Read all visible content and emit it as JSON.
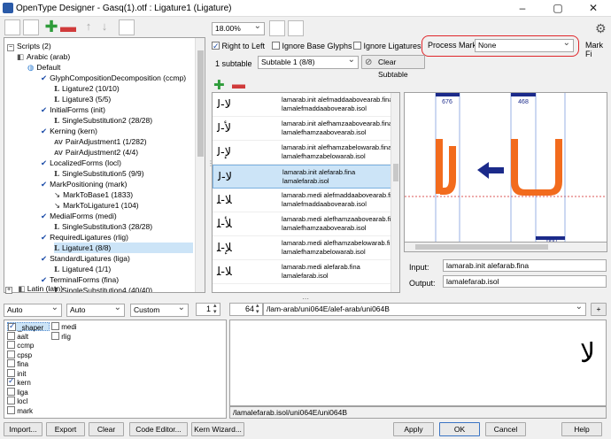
{
  "window": {
    "title": "OpenType Designer - Gasq(1).otf : Ligature1 (Ligature)"
  },
  "tree": {
    "items": [
      {
        "label": "Scripts (2)",
        "level": 0,
        "checked": null,
        "icon": "minus"
      },
      {
        "label": "Arabic (arab)",
        "level": 1,
        "checked": null,
        "icon": "script"
      },
      {
        "label": "Default",
        "level": 2,
        "checked": null,
        "icon": "lang"
      },
      {
        "label": "GlyphCompositionDecomposition (ccmp)",
        "level": 3,
        "checked": true,
        "icon": "feature"
      },
      {
        "label": "Ligature2 (10/10)",
        "level": 4,
        "checked": null,
        "icon": "lookup-L"
      },
      {
        "label": "Ligature3 (5/5)",
        "level": 4,
        "checked": null,
        "icon": "lookup-L"
      },
      {
        "label": "InitialForms (init)",
        "level": 3,
        "checked": true,
        "icon": "feature"
      },
      {
        "label": "SingleSubstitution2 (28/28)",
        "level": 4,
        "checked": null,
        "icon": "lookup-L"
      },
      {
        "label": "Kerning (kern)",
        "level": 3,
        "checked": true,
        "icon": "feature"
      },
      {
        "label": "PairAdjustment1 (1/282)",
        "level": 4,
        "checked": null,
        "icon": "lookup-AV"
      },
      {
        "label": "PairAdjustment2 (4/4)",
        "level": 4,
        "checked": null,
        "icon": "lookup-AV"
      },
      {
        "label": "LocalizedForms (locl)",
        "level": 3,
        "checked": true,
        "icon": "feature"
      },
      {
        "label": "SingleSubstitution5 (9/9)",
        "level": 4,
        "checked": null,
        "icon": "lookup-L"
      },
      {
        "label": "MarkPositioning (mark)",
        "level": 3,
        "checked": true,
        "icon": "feature"
      },
      {
        "label": "MarkToBase1 (1833)",
        "level": 4,
        "checked": null,
        "icon": "lookup-mark"
      },
      {
        "label": "MarkToLigature1 (104)",
        "level": 4,
        "checked": null,
        "icon": "lookup-mark"
      },
      {
        "label": "MedialForms (medi)",
        "level": 3,
        "checked": true,
        "icon": "feature"
      },
      {
        "label": "SingleSubstitution3 (28/28)",
        "level": 4,
        "checked": null,
        "icon": "lookup-L"
      },
      {
        "label": "RequiredLigatures (rlig)",
        "level": 3,
        "checked": true,
        "icon": "feature"
      },
      {
        "label": "Ligature1 (8/8)",
        "level": 4,
        "checked": null,
        "icon": "lookup-L",
        "selected": true
      },
      {
        "label": "StandardLigatures (liga)",
        "level": 3,
        "checked": true,
        "icon": "feature"
      },
      {
        "label": "Ligature4 (1/1)",
        "level": 4,
        "checked": null,
        "icon": "lookup-L"
      },
      {
        "label": "TerminalForms (fina)",
        "level": 3,
        "checked": true,
        "icon": "feature"
      },
      {
        "label": "SingleSubstitution4 (40/40)",
        "level": 4,
        "checked": null,
        "icon": "lookup-L"
      }
    ],
    "latin_label": "Latin (latn)"
  },
  "top": {
    "zoom": "18.00%",
    "right_to_left": "Right to Left",
    "ignore_base": "Ignore Base Glyphs",
    "ignore_lig": "Ignore Ligatures",
    "process_marks_label": "Process Marks:",
    "process_marks_value": "None",
    "mark_filter": "Mark Fi",
    "subtable_count": "1 subtable",
    "subtable_value": "Subtable 1 (8/8)",
    "clear_subtable": "Clear Subtable"
  },
  "rows": [
    {
      "glyph": "ﻻ-ﻟ",
      "line1": "lamarab.init alefmaddaabovearab.fina",
      "line2": "lamalefmaddaabovearab.isol"
    },
    {
      "glyph": "ﻷ-ﻟ",
      "line1": "lamarab.init alefhamzaabovearab.fina",
      "line2": "lamalefhamzaabovearab.isol"
    },
    {
      "glyph": "ﻹ-ﻟ",
      "line1": "lamarab.init alefhamzabelowarab.fina",
      "line2": "lamalefhamzabelowarab.isol"
    },
    {
      "glyph": "ﻻ-ﻟ",
      "line1": "lamarab.init alefarab.fina",
      "line2": "lamalefarab.isol",
      "selected": true
    },
    {
      "glyph": "ﻼ-ﻠ",
      "line1": "lamarab.medi alefmaddaabovearab.fina",
      "line2": "lamalefmaddaabovearab.isol"
    },
    {
      "glyph": "ﻸ-ﻠ",
      "line1": "lamarab.medi alefhamzaabovearab.fina",
      "line2": "lamalefhamzaabovearab.isol"
    },
    {
      "glyph": "ﻺ-ﻠ",
      "line1": "lamarab.medi alefhamzabelowarab.fina",
      "line2": "lamalefhamzabelowarab.isol"
    },
    {
      "glyph": "ﻼ-ﻠ",
      "line1": "lamarab.medi alefarab.fina",
      "line2": "lamalefarab.isol"
    }
  ],
  "preview": {
    "measure_1": "676",
    "measure_2": "468",
    "measure_3": "660",
    "input_label": "Input:",
    "input_value": "lamarab.init alefarab.fina",
    "output_label": "Output:",
    "output_value": "lamalefarab.isol",
    "accent": "#f26b1d"
  },
  "bottom": {
    "auto1": "Auto",
    "auto2": "Auto",
    "custom": "Custom",
    "spin_value": "1",
    "size_value": "64",
    "text_value": "/lam-arab/uni064E/alef-arab/uni064B",
    "plus": "+",
    "status": "/lamalefarab.isol/uni064E/uni064B",
    "features_col1": [
      {
        "tag": "_shaper",
        "checked": true,
        "selected": true
      },
      {
        "tag": "aalt",
        "checked": false
      },
      {
        "tag": "ccmp",
        "checked": false
      },
      {
        "tag": "cpsp",
        "checked": false
      },
      {
        "tag": "fina",
        "checked": false
      },
      {
        "tag": "init",
        "checked": false
      },
      {
        "tag": "kern",
        "checked": true
      },
      {
        "tag": "liga",
        "checked": false
      },
      {
        "tag": "locl",
        "checked": false
      },
      {
        "tag": "mark",
        "checked": false
      }
    ],
    "features_col2": [
      {
        "tag": "medi",
        "checked": false
      },
      {
        "tag": "rlig",
        "checked": false
      }
    ]
  },
  "buttons": {
    "import": "Import...",
    "export": "Export",
    "clear": "Clear",
    "code_editor": "Code Editor...",
    "kern_wizard": "Kern Wizard...",
    "apply": "Apply",
    "ok": "OK",
    "cancel": "Cancel",
    "help": "Help"
  }
}
